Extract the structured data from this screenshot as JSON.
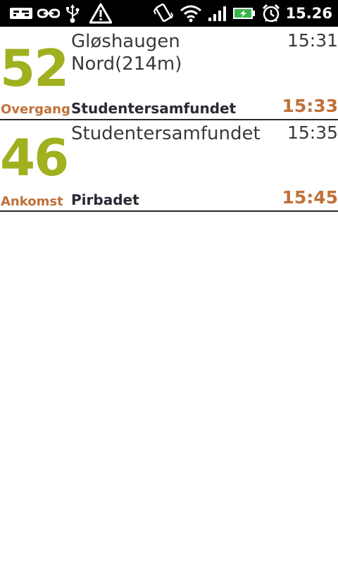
{
  "status_bar": {
    "time": "15.26",
    "icons": [
      "message-icon",
      "link-icon",
      "usb-icon",
      "warning-icon",
      "vibrate-icon",
      "wifi-icon",
      "signal-icon",
      "battery-charging-icon",
      "alarm-icon"
    ],
    "battery_color": "#39b54a"
  },
  "colors": {
    "route": "#a0b01e",
    "accent": "#c0703a",
    "text": "#3a3a3a"
  },
  "trips": [
    {
      "route": "52",
      "kind": "Overgang",
      "from_stop": "Gløshaugen Nord(214m)",
      "dep_time": "15:31",
      "to_stop": "Studentersamfundet",
      "arr_time": "15:33"
    },
    {
      "route": "46",
      "kind": "Ankomst",
      "from_stop": "Studentersamfundet",
      "dep_time": "15:35",
      "to_stop": "Pirbadet",
      "arr_time": "15:45"
    }
  ]
}
